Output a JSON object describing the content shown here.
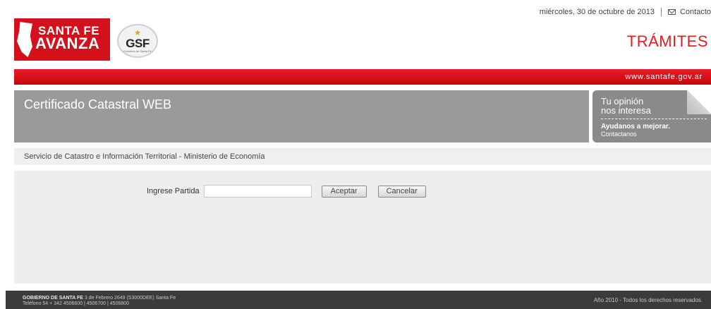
{
  "topbar": {
    "date": "miércoles, 30 de octubre de 2013",
    "contact_label": "Contacto"
  },
  "logos": {
    "santafe_line1": "SANTA FE",
    "santafe_line2": "AVANZA",
    "gsf_text": "GSF",
    "gsf_sub": "Gobierno de Santa Fe"
  },
  "header": {
    "section_title": "TRÁMITES",
    "site_url": "www.santafe.gov.ar"
  },
  "banner": {
    "title": "Certificado Catastral WEB"
  },
  "opinion": {
    "line1": "Tu opinión",
    "line2": "nos interesa",
    "line3": "Ayudanos a mejorar.",
    "line4": "Contactanos"
  },
  "subheader": {
    "text": "Servicio de Catastro e Información Territorial - Ministerio de Economía"
  },
  "form": {
    "partida_label": "Ingrese Partida",
    "partida_value": "",
    "accept_label": "Aceptar",
    "cancel_label": "Cancelar"
  },
  "footer": {
    "org": "GOBIERNO DE SANTA FE",
    "address": "3 de Febrero 2649 (S3000DEE) Santa Fe",
    "phone": "Teléfono 54 + 342 4506600 | 4506700 | 4506800",
    "copyright": "Año 2010 - Todos los derechos reservados."
  }
}
